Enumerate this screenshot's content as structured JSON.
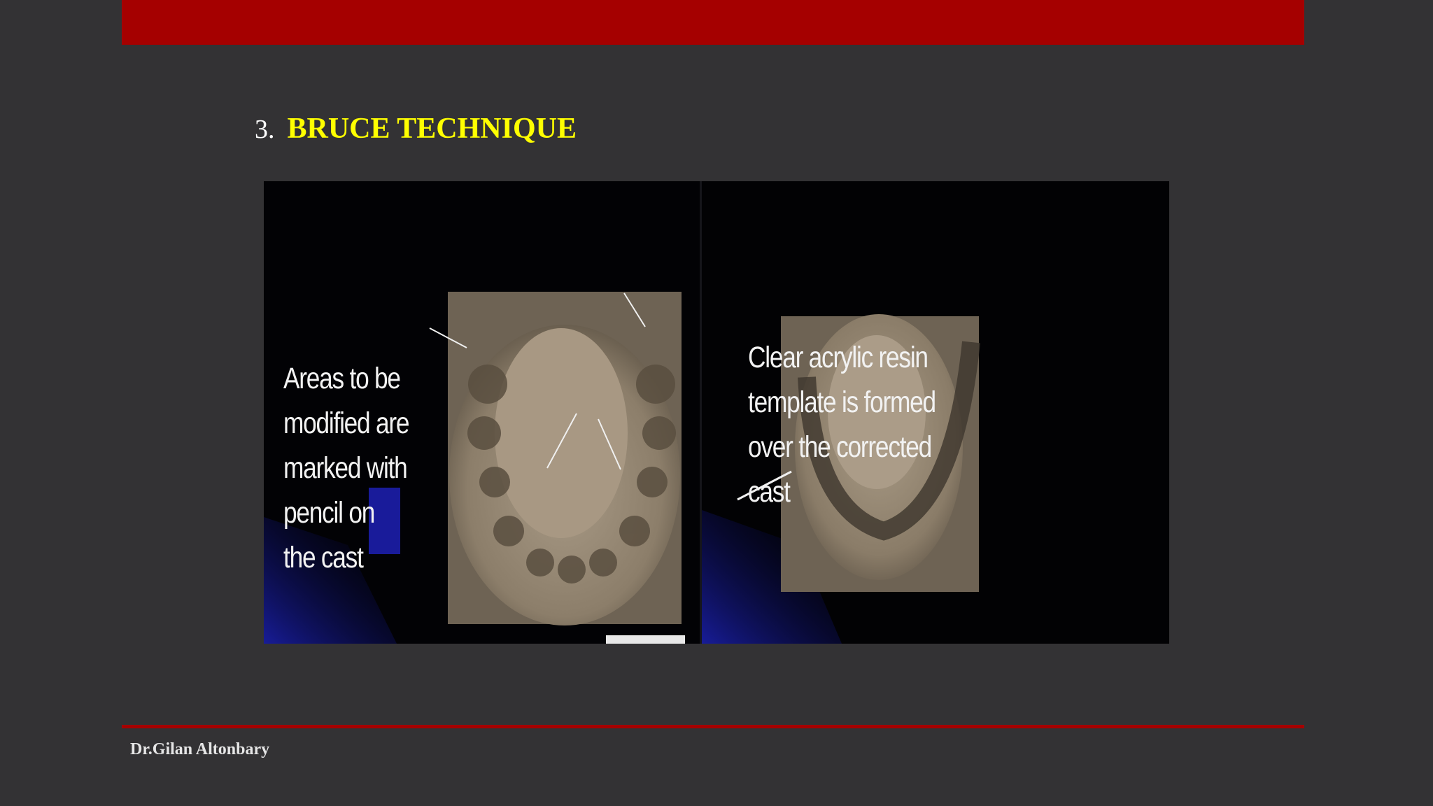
{
  "slide": {
    "title_number": "3.",
    "title_text": "BRUCE TECHNIQUE",
    "footer_author": "Dr.Gilan Altonbary"
  },
  "figure": {
    "left_caption": "Areas to be\nmodified are\nmarked with\npencil on\nthe cast",
    "right_caption": "Clear acrylic resin\n template is formed\n over the corrected\n cast"
  },
  "colors": {
    "accent_red": "#a50000",
    "title_yellow": "#ffff00",
    "background": "#333234"
  }
}
